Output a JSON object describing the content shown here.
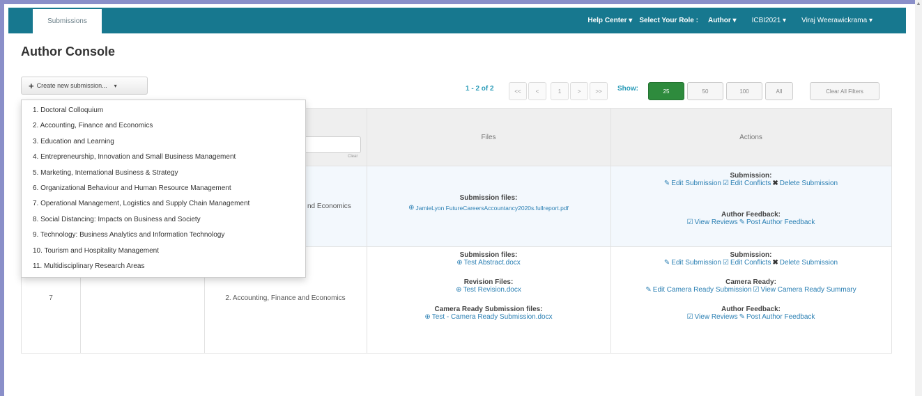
{
  "navbar": {
    "tab_label": "Submissions",
    "help_center": "Help Center",
    "select_role_label": "Select Your Role :",
    "role": "Author",
    "conference": "ICBI2021",
    "user_name": "Viraj Weerawickrama"
  },
  "page": {
    "title": "Author Console"
  },
  "toolbar": {
    "create_label": "Create new submission..."
  },
  "pager": {
    "range_text": "1 - 2 of 2",
    "first": "<<",
    "prev": "<",
    "current": "1",
    "next": ">",
    "last": ">>",
    "show_label": "Show:",
    "show_options": [
      "25",
      "50",
      "100",
      "All"
    ],
    "selected": "25",
    "clear_filters": "Clear All Filters"
  },
  "dropdown": {
    "items": [
      "1. Doctoral Colloquium",
      "2. Accounting, Finance and Economics",
      "3. Education and Learning",
      "4. Entrepreneurship, Innovation and Small Business Management",
      "5. Marketing, International Business & Strategy",
      "6. Organizational Behaviour and Human Resource Management",
      "7. Operational Management, Logistics and Supply Chain Management",
      "8. Social Distancing: Impacts on Business and Society",
      "9. Technology: Business Analytics and Information Technology",
      "10. Tourism and Hospitality Management",
      "11. Multidisciplinary Research Areas"
    ]
  },
  "table": {
    "headers": {
      "files": "Files",
      "actions": "Actions"
    },
    "filter_clear": "Clear",
    "rows": [
      {
        "category_fragment": "nd Economics",
        "files_label": "Submission files:",
        "file": "JamieLyon FutureCareersAccountancy2020s.fullreport.pdf",
        "submission_label": "Submission:",
        "edit_submission": "Edit Submission",
        "edit_conflicts": "Edit Conflicts",
        "delete_submission": "Delete Submission",
        "feedback_label": "Author Feedback:",
        "view_reviews": "View Reviews",
        "post_feedback": "Post Author Feedback"
      },
      {
        "id": "7",
        "category": "2. Accounting, Finance and Economics",
        "files_label": "Submission files:",
        "file": "Test Abstract.docx",
        "revision_label": "Revision Files:",
        "revision_file": "Test Revision.docx",
        "camera_files_label": "Camera Ready Submission files:",
        "camera_file": "Test - Camera Ready Submission.docx",
        "submission_label": "Submission:",
        "edit_submission": "Edit Submission",
        "edit_conflicts": "Edit Conflicts",
        "delete_submission": "Delete Submission",
        "camera_label": "Camera Ready:",
        "edit_camera": "Edit Camera Ready Submission",
        "view_camera": "View Camera Ready Summary",
        "feedback_label": "Author Feedback:",
        "view_reviews": "View Reviews",
        "post_feedback": "Post Author Feedback"
      }
    ]
  },
  "colors": {
    "navbar": "#17788f",
    "link": "#2a7fb3",
    "accent": "#2a9bb8",
    "active_button": "#2e8b3d"
  }
}
